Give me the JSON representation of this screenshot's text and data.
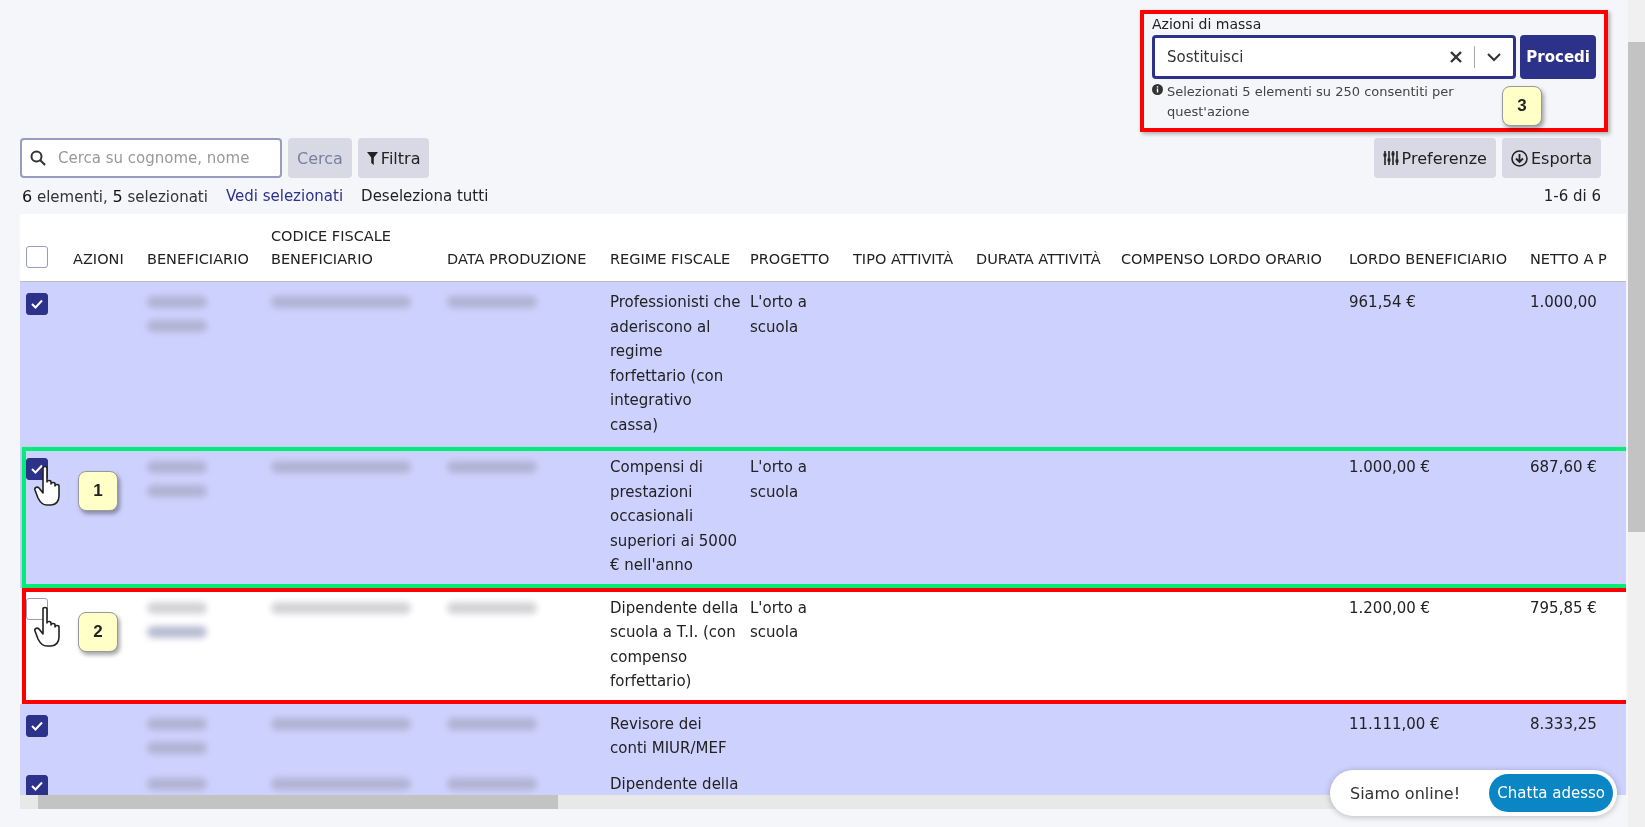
{
  "mass_actions": {
    "label": "Azioni di massa",
    "value": "Sostituisci",
    "button": "Procedi",
    "hint": "Selezionati 5 elementi su 250 consentiti per quest'azione",
    "highlight": {
      "color": "#ff0000",
      "callout": "3"
    }
  },
  "search": {
    "placeholder": "Cerca su cognome, nome",
    "button": "Cerca",
    "button_disabled": true
  },
  "filter_button": "Filtra",
  "preferences_button": "Preferenze",
  "export_button": "Esporta",
  "summary": {
    "count": "6",
    "count_label": "elementi,",
    "selected": "5",
    "selected_label": "selezionati",
    "view_selected": "Vedi selezionati",
    "deselect_all": "Deseleziona tutti",
    "pagination": "1-6 di 6"
  },
  "table": {
    "select_all_checked": false,
    "columns": [
      "AZIONI",
      "BENEFICIARIO",
      "CODICE FISCALE BENEFICIARIO",
      "DATA PRODUZIONE",
      "REGIME FISCALE",
      "PROGETTO",
      "TIPO ATTIVITÀ",
      "DURATA ATTIVITÀ",
      "COMPENSO LORDO ORARIO",
      "LORDO BENEFICIARIO",
      "NETTO A P"
    ],
    "rows": [
      {
        "selected": true,
        "regime": "Professionisti che aderiscono al regime forfettario (con integrativo cassa)",
        "progetto": "L'orto a scuola",
        "lordo": "961,54 €",
        "netto": "1.000,00"
      },
      {
        "selected": true,
        "regime": "Compensi di prestazioni occasionali superiori ai 5000 € nell'anno",
        "progetto": "L'orto a scuola",
        "lordo": "1.000,00 €",
        "netto": "687,60 €",
        "highlight": {
          "color": "#00ee77",
          "callout": "1"
        }
      },
      {
        "selected": false,
        "regime": "Dipendente della scuola a T.I. (con compenso forfettario)",
        "progetto": "L'orto a scuola",
        "lordo": "1.200,00 €",
        "netto": "795,85 €",
        "highlight": {
          "color": "#ff0000",
          "callout": "2"
        }
      },
      {
        "selected": true,
        "regime": "Revisore dei conti MIUR/MEF",
        "lordo": "11.111,00 €",
        "netto": "8.333,25"
      },
      {
        "selected": true,
        "regime": "Dipendente della"
      }
    ]
  },
  "chat": {
    "text": "Siamo online!",
    "button": "Chatta adesso"
  }
}
